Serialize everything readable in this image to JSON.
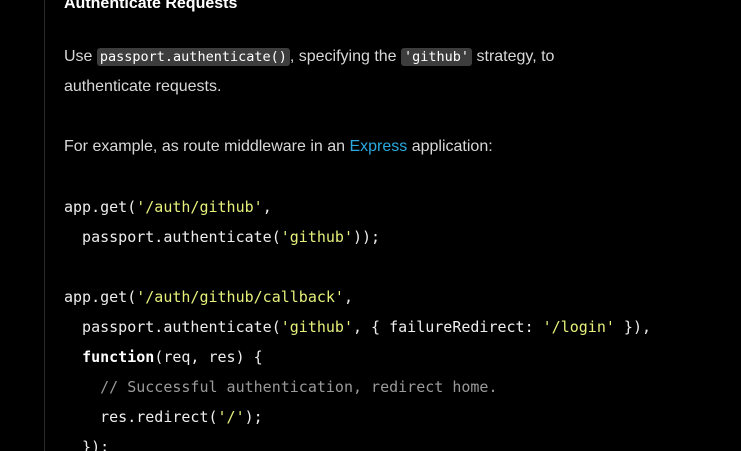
{
  "section": {
    "heading": "Authenticate Requests"
  },
  "para1": {
    "t1": "Use ",
    "code1": "passport.authenticate()",
    "t2": ", specifying the ",
    "code2": "'github'",
    "t3": " strategy, to",
    "t4": "authenticate requests."
  },
  "para2": {
    "t1": "For example, as route middleware in an ",
    "link": "Express",
    "t2": " application:"
  },
  "code": {
    "l1a": "app.get(",
    "l1b": "'/auth/github'",
    "l1c": ",",
    "l2a": "  passport.authenticate(",
    "l2b": "'github'",
    "l2c": "));",
    "l4a": "app.get(",
    "l4b": "'/auth/github/callback'",
    "l4c": ",",
    "l5a": "  passport.authenticate(",
    "l5b": "'github'",
    "l5c": ", { failureRedirect: ",
    "l5d": "'/login'",
    "l5e": " }),",
    "l6a": "  ",
    "l6b": "function",
    "l6c": "(req, res) {",
    "l7": "    // Successful authentication, redirect home.",
    "l8a": "    res.redirect(",
    "l8b": "'/'",
    "l8c": ");",
    "l9": "  });"
  }
}
